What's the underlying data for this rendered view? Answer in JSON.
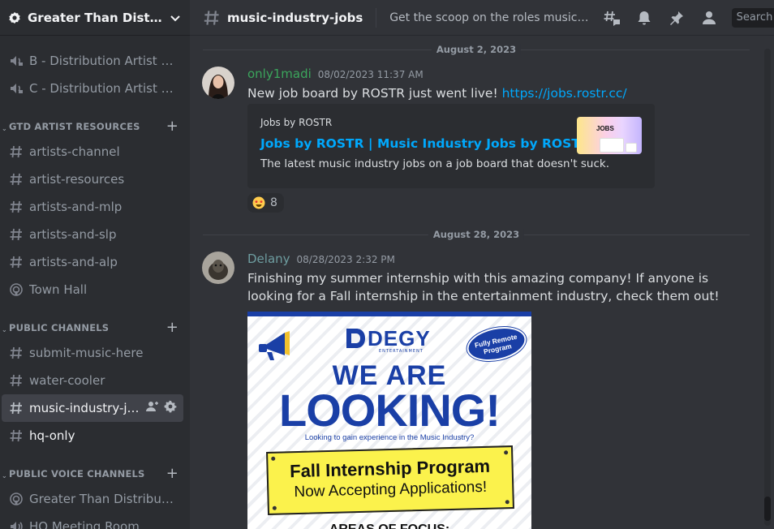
{
  "server": {
    "name": "Greater Than Distrib..."
  },
  "sidebar": {
    "top_channels": [
      {
        "label": "B - Distribution Artist R...",
        "icon": "speaker-lock-icon"
      },
      {
        "label": "C - Distribution Artist R...",
        "icon": "speaker-lock-icon"
      }
    ],
    "categories": [
      {
        "label": "GTD ARTIST RESOURCES",
        "channels": [
          {
            "label": "artists-channel",
            "icon": "hash-icon"
          },
          {
            "label": "artist-resources",
            "icon": "hash-icon"
          },
          {
            "label": "artists-and-mlp",
            "icon": "hash-icon"
          },
          {
            "label": "artists-and-slp",
            "icon": "hash-icon"
          },
          {
            "label": "artists-and-alp",
            "icon": "hash-icon"
          },
          {
            "label": "Town Hall",
            "icon": "stage-icon"
          }
        ]
      },
      {
        "label": "PUBLIC CHANNELS",
        "channels": [
          {
            "label": "submit-music-here",
            "icon": "hash-icon"
          },
          {
            "label": "water-cooler",
            "icon": "hash-icon"
          },
          {
            "label": "music-industry-jobs",
            "icon": "hash-icon",
            "active": true
          },
          {
            "label": "hq-only",
            "icon": "hash-icon"
          }
        ]
      },
      {
        "label": "PUBLIC VOICE CHANNELS",
        "channels": [
          {
            "label": "Greater Than Distributio...",
            "icon": "stage-icon"
          },
          {
            "label": "HQ Meeting Room",
            "icon": "speaker-icon"
          }
        ]
      }
    ]
  },
  "header": {
    "channel_name": "music-industry-jobs",
    "topic": "Get the scoop on the roles music companies a...",
    "search_placeholder": "Search"
  },
  "messages": [
    {
      "date": "August 2, 2023",
      "username": "only1madi",
      "username_color": "#3ba55c",
      "timestamp": "08/02/2023 11:37 AM",
      "text": "New job board by ROSTR just went live! ",
      "link": "https://jobs.rostr.cc/",
      "embed": {
        "provider": "Jobs by ROSTR",
        "title": "Jobs by ROSTR | Music Industry Jobs by ROSTR",
        "description": "The latest music industry jobs on a job board that doesn't suck.",
        "thumb_text": "JOBS"
      },
      "reaction": {
        "emoji": "star-struck-emoji",
        "count": "8"
      }
    },
    {
      "date": "August 28, 2023",
      "username": "Delany",
      "username_color": "#6e9da0",
      "timestamp": "08/28/2023 2:32 PM",
      "text": "Finishing my summer internship with this amazing company! If anyone is looking for a Fall internship in the entertainment industry, check them out!",
      "attachment": {
        "logo": "DEGY",
        "logo_sub": "ENTERTAINMENT",
        "badge": "Fully Remote Program",
        "headline1": "WE ARE",
        "headline2": "LOOKING!",
        "subline": "Looking to gain experience in the Music Industry?",
        "box_line1": "Fall Internship Program",
        "box_line2": "Now Accepting Applications!",
        "areas": "AREAS OF FOCUS:"
      }
    }
  ],
  "colors": {
    "accent_link": "#00a8fc",
    "poster_blue": "#1a3fa6",
    "poster_yellow": "#fbf24c"
  }
}
